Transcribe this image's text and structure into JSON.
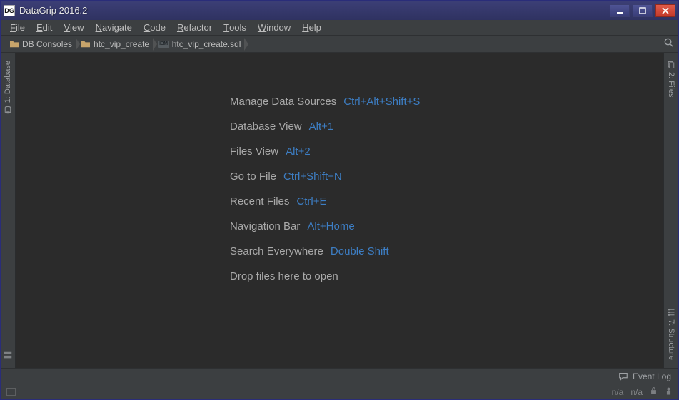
{
  "titlebar": {
    "app_icon_label": "DG",
    "title": "DataGrip 2016.2"
  },
  "menus": [
    {
      "label": "File",
      "u": 0
    },
    {
      "label": "Edit",
      "u": 0
    },
    {
      "label": "View",
      "u": 0
    },
    {
      "label": "Navigate",
      "u": 0
    },
    {
      "label": "Code",
      "u": 0
    },
    {
      "label": "Refactor",
      "u": 0
    },
    {
      "label": "Tools",
      "u": 0
    },
    {
      "label": "Window",
      "u": 0
    },
    {
      "label": "Help",
      "u": 0
    }
  ],
  "breadcrumbs": [
    {
      "icon": "folder",
      "label": "DB Consoles"
    },
    {
      "icon": "folder",
      "label": "htc_vip_create"
    },
    {
      "icon": "ibm",
      "label": "htc_vip_create.sql"
    }
  ],
  "left_tools": [
    {
      "label": "1: Database"
    }
  ],
  "left_bottom_icon": "storage-icon",
  "right_tools": [
    {
      "label": "2: Files"
    },
    {
      "label": "7: Structure"
    }
  ],
  "tips": [
    {
      "label": "Manage Data Sources",
      "shortcut": "Ctrl+Alt+Shift+S"
    },
    {
      "label": "Database View",
      "shortcut": "Alt+1"
    },
    {
      "label": "Files View",
      "shortcut": "Alt+2"
    },
    {
      "label": "Go to File",
      "shortcut": "Ctrl+Shift+N"
    },
    {
      "label": "Recent Files",
      "shortcut": "Ctrl+E"
    },
    {
      "label": "Navigation Bar",
      "shortcut": "Alt+Home"
    },
    {
      "label": "Search Everywhere",
      "shortcut": "Double Shift"
    },
    {
      "label": "Drop files here to open",
      "shortcut": null
    }
  ],
  "eventlog_label": "Event Log",
  "status": {
    "left_box": "",
    "col1": "n/a",
    "col2": "n/a"
  }
}
